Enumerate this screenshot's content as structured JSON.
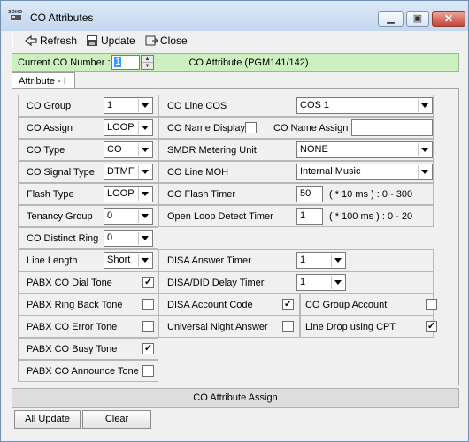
{
  "window": {
    "title": "CO Attributes",
    "logo_text": "SOHO"
  },
  "toolbar": {
    "refresh": "Refresh",
    "update": "Update",
    "close": "Close"
  },
  "info": {
    "current_label": "Current CO Number :",
    "current_value": "1",
    "title": "CO Attribute (PGM141/142)"
  },
  "tabs": [
    {
      "label": "Attribute - I"
    }
  ],
  "left": {
    "co_group": {
      "label": "CO Group",
      "value": "1"
    },
    "co_assign": {
      "label": "CO Assign",
      "value": "LOOP"
    },
    "co_type": {
      "label": "CO Type",
      "value": "CO"
    },
    "co_signal_type": {
      "label": "CO Signal Type",
      "value": "DTMF"
    },
    "flash_type": {
      "label": "Flash Type",
      "value": "LOOP"
    },
    "tenancy_group": {
      "label": "Tenancy Group",
      "value": "0"
    },
    "co_distinct_ring": {
      "label": "CO Distinct Ring",
      "value": "0"
    },
    "line_length": {
      "label": "Line Length",
      "value": "Short"
    },
    "pabx_co_dial_tone": {
      "label": "PABX CO Dial Tone",
      "checked": "✓"
    },
    "pabx_ring_back_tone": {
      "label": "PABX Ring Back Tone",
      "checked": ""
    },
    "pabx_co_error_tone": {
      "label": "PABX CO Error Tone",
      "checked": ""
    },
    "pabx_co_busy_tone": {
      "label": "PABX CO Busy Tone",
      "checked": "✓"
    },
    "pabx_co_announce_tone": {
      "label": "PABX CO Announce Tone",
      "checked": ""
    }
  },
  "right": {
    "co_line_cos": {
      "label": "CO Line COS",
      "value": "COS 1"
    },
    "co_name_display": {
      "label": "CO Name Display",
      "checked": ""
    },
    "co_name_assign": {
      "label": "CO Name Assign",
      "value": ""
    },
    "smdr_metering_unit": {
      "label": "SMDR Metering Unit",
      "value": "NONE"
    },
    "co_line_moh": {
      "label": "CO Line MOH",
      "value": "Internal Music"
    },
    "co_flash_timer": {
      "label": "CO Flash Timer",
      "value": "50",
      "range": "( * 10 ms ) : 0 - 300"
    },
    "open_loop_detect_timer": {
      "label": "Open Loop Detect Timer",
      "value": "1",
      "range": "( * 100 ms ) : 0 - 20"
    },
    "disa_answer_timer": {
      "label": "DISA Answer Timer",
      "value": "1"
    },
    "disa_did_delay_timer": {
      "label": "DISA/DID Delay Timer",
      "value": "1"
    },
    "disa_account_code": {
      "label": "DISA Account Code",
      "checked": "✓"
    },
    "universal_night_answer": {
      "label": "Universal Night Answer",
      "checked": ""
    },
    "co_group_account": {
      "label": "CO Group Account",
      "checked": ""
    },
    "line_drop_using_cpt": {
      "label": "Line Drop using CPT",
      "checked": "✓"
    }
  },
  "bottom": {
    "title": "CO Attribute Assign",
    "all_update": "All Update",
    "clear": "Clear"
  }
}
